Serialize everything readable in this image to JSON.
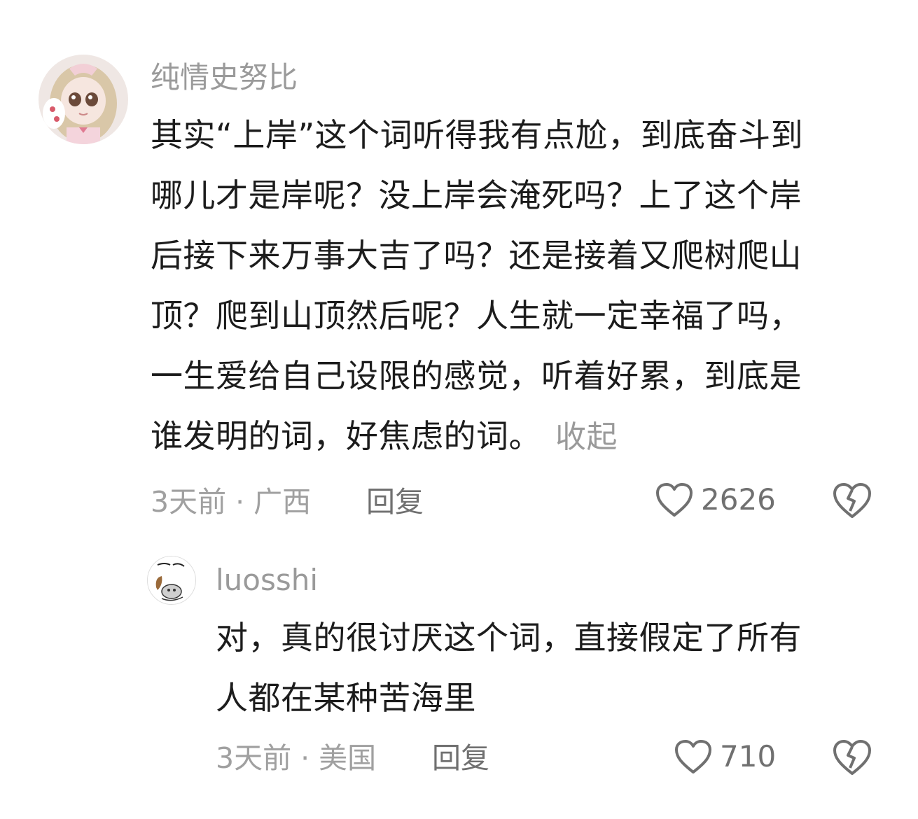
{
  "top_fragment": "",
  "comments": [
    {
      "username": "纯情史努比",
      "lines": [
        "其实“上岸”这个词听得我有点尬，到底奋斗到",
        "哪儿才是岸呢？没上岸会淹死吗？上了这个岸",
        "后接下来万事大吉了吗？还是接着又爬树爬山",
        "顶？爬到山顶然后呢？人生就一定幸福了吗，",
        "一生爱给自己设限的感觉，听着好累，到底是",
        "谁发明的词，好焦虑的词。"
      ],
      "collapse_label": "收起",
      "time_location": "3天前 · 广西",
      "reply_label": "回复",
      "like_count": "2626",
      "like_icon": "heart-outline-icon",
      "dislike_icon": "broken-heart-icon"
    },
    {
      "username": "luosshi",
      "lines": [
        "对，真的很讨厌这个词，直接假定了所有",
        "人都在某种苦海里"
      ],
      "time_location": "3天前 · 美国",
      "reply_label": "回复",
      "like_count": "710",
      "like_icon": "heart-outline-icon",
      "dislike_icon": "broken-heart-icon"
    }
  ]
}
